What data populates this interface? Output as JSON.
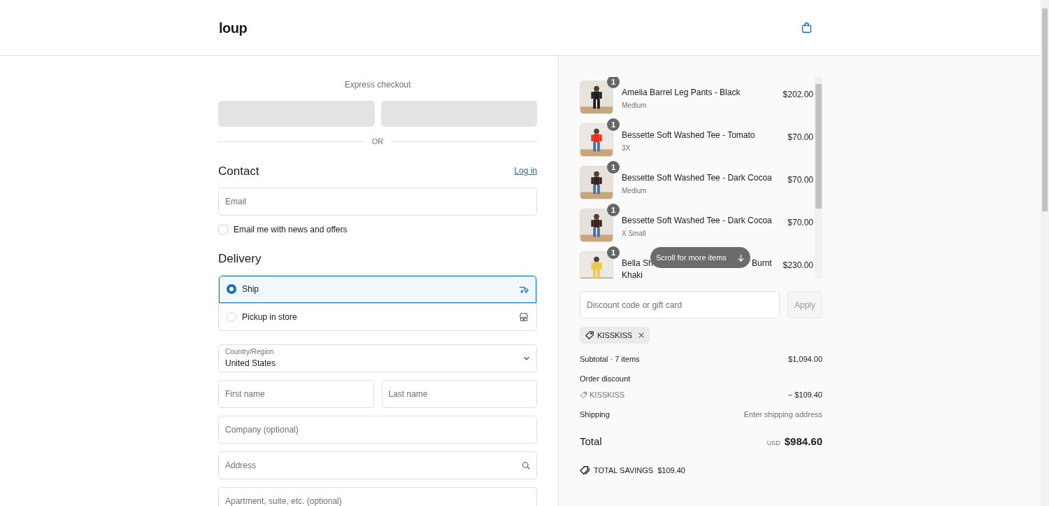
{
  "header": {
    "logo": "loup"
  },
  "express": {
    "title": "Express checkout",
    "divider": "OR"
  },
  "contact": {
    "title": "Contact",
    "login": "Log in",
    "email": {
      "placeholder": "Email"
    },
    "newsletter": {
      "label": "Email me with news and offers",
      "checked": false
    }
  },
  "delivery": {
    "title": "Delivery",
    "options": [
      {
        "label": "Ship",
        "kind": "ship",
        "selected": true
      },
      {
        "label": "Pickup in store",
        "kind": "store",
        "selected": false
      }
    ]
  },
  "address": {
    "country": {
      "label": "Country/Region",
      "value": "United States"
    },
    "first_name": {
      "placeholder": "First name"
    },
    "last_name": {
      "placeholder": "Last name"
    },
    "company": {
      "placeholder": "Company (optional)"
    },
    "address": {
      "placeholder": "Address"
    },
    "apartment": {
      "placeholder": "Apartment, suite, etc. (optional)"
    }
  },
  "cart": {
    "items": [
      {
        "quantity": "1",
        "name": "Amelia Barrel Leg Pants - Black",
        "variant": "Medium",
        "price": "$202.00"
      },
      {
        "quantity": "1",
        "name": "Bessette Soft Washed Tee - Tomato",
        "variant": "3X",
        "price": "$70.00"
      },
      {
        "quantity": "1",
        "name": "Bessette Soft Washed Tee - Dark Cocoa",
        "variant": "Medium",
        "price": "$70.00"
      },
      {
        "quantity": "1",
        "name": "Bessette Soft Washed Tee - Dark Cocoa",
        "variant": "X Small",
        "price": "$70.00"
      },
      {
        "quantity": "1",
        "name_start": "Bella Sh",
        "name_end": "Burnt",
        "name_line2": "Khaki",
        "price": "$230.00"
      }
    ],
    "scroll_hint": "Scroll for more items"
  },
  "discount": {
    "placeholder": "Discount code or gift card",
    "apply": "Apply",
    "applied_code": "KISSKISS"
  },
  "summary": {
    "subtotal_label": "Subtotal · 7 items",
    "subtotal": "$1,094.00",
    "order_discount_label": "Order discount",
    "discount_code": "KISSKISS",
    "discount_amount": "− $109.40",
    "shipping_label": "Shipping",
    "shipping": "Enter shipping address",
    "total_label": "Total",
    "currency": "USD",
    "total": "$984.60",
    "savings_label": "TOTAL SAVINGS",
    "savings": "$109.40"
  }
}
